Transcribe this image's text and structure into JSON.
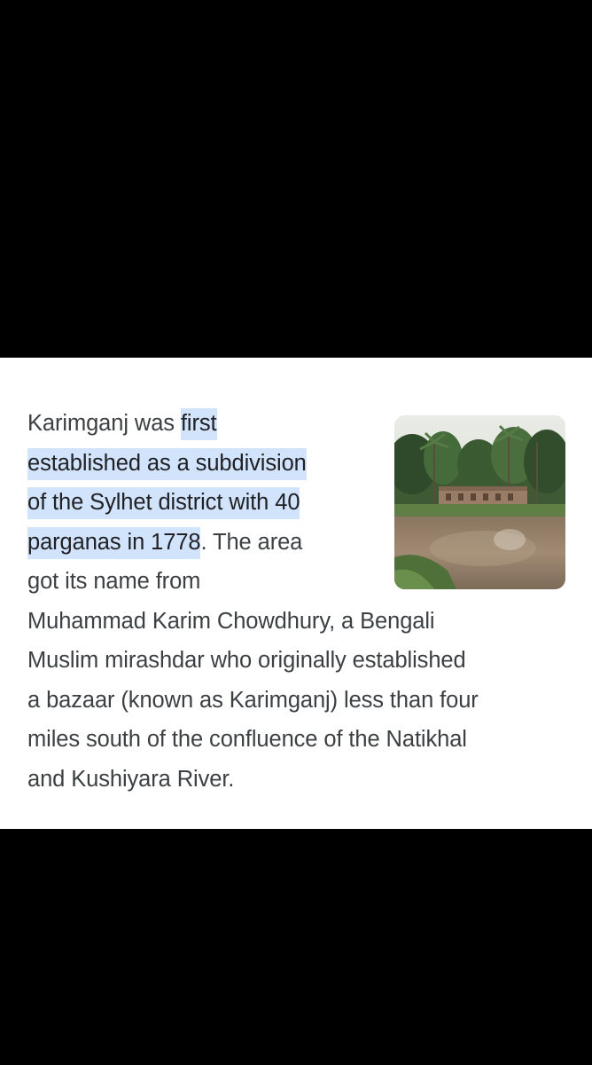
{
  "snippet": {
    "line1_plain": "Karimganj was ",
    "line1_highlight": "first",
    "line2_highlight": "established as a subdivision",
    "line3_highlight": "of the Sylhet district with 40",
    "line4_highlight": "parganas in 1778",
    "line4_plain": ". The area",
    "line5": "got its name from",
    "line6": "Muhammad Karim Chowdhury, a Bengali",
    "line7": "Muslim mirashdar who originally established",
    "line8": "a bazaar (known as Karimganj) less than four",
    "line9": "miles south of the confluence of the Natikhal",
    "line10": "and Kushiyara River."
  },
  "thumbnail": {
    "icon": "photo-thumbnail"
  },
  "colors": {
    "background": "#000000",
    "card": "#ffffff",
    "text": "#3c4043",
    "highlight": "#d2e3fc"
  }
}
